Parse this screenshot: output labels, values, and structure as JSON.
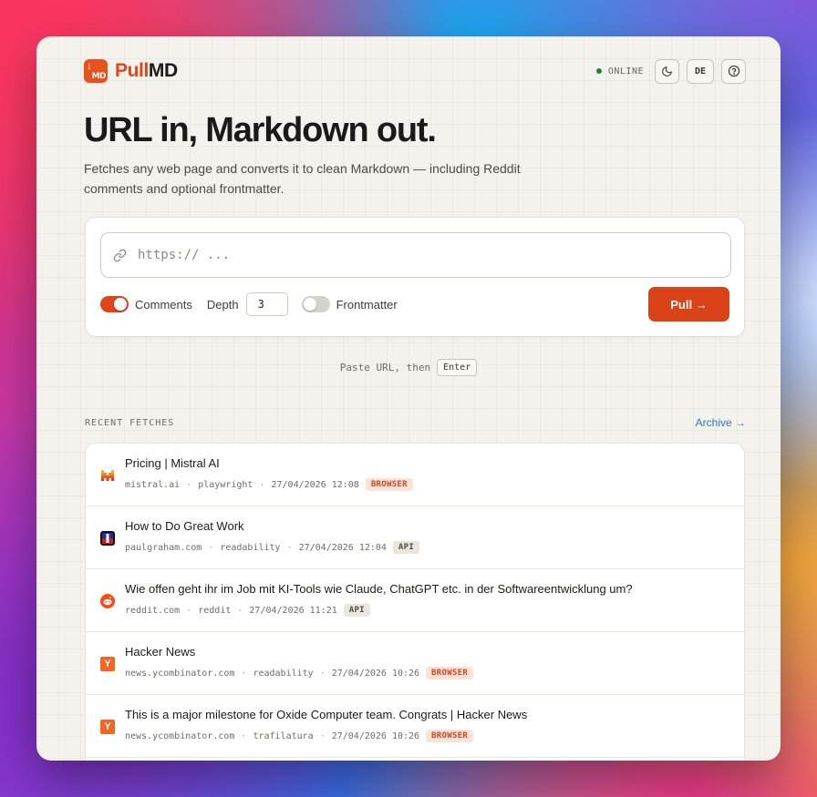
{
  "brand": {
    "name_part1": "Pull",
    "name_part2": "MD"
  },
  "status": {
    "text": "ONLINE",
    "color": "#2f7a33"
  },
  "header_buttons": {
    "theme_icon": "moon-icon",
    "language": "DE",
    "help_icon": "help-icon"
  },
  "hero": {
    "title": "URL in, Markdown out.",
    "subtitle": "Fetches any web page and converts it to clean Markdown — including Reddit comments and optional frontmatter."
  },
  "fetch_form": {
    "url_placeholder": "https:// ...",
    "url_value": "",
    "comments_label": "Comments",
    "comments_enabled": true,
    "depth_label": "Depth",
    "depth_value": "3",
    "frontmatter_label": "Frontmatter",
    "frontmatter_enabled": false,
    "pull_label": "Pull →",
    "accent_color": "#da4318"
  },
  "hint": {
    "text": "Paste URL, then",
    "key": "Enter"
  },
  "recent": {
    "title": "RECENT FETCHES",
    "archive_label": "Archive →",
    "items": [
      {
        "title": "Pricing | Mistral AI",
        "domain": "mistral.ai",
        "extractor": "playwright",
        "time": "27/04/2026 12:08",
        "badge": "BROWSER",
        "favicon": "mistral-icon"
      },
      {
        "title": "How to Do Great Work",
        "domain": "paulgraham.com",
        "extractor": "readability",
        "time": "27/04/2026 12:04",
        "badge": "API",
        "favicon": "paulgraham-icon"
      },
      {
        "title": "Wie offen geht ihr im Job mit KI-Tools wie Claude, ChatGPT etc. in der Softwareentwicklung um?",
        "domain": "reddit.com",
        "extractor": "reddit",
        "time": "27/04/2026 11:21",
        "badge": "API",
        "favicon": "reddit-icon"
      },
      {
        "title": "Hacker News",
        "domain": "news.ycombinator.com",
        "extractor": "readability",
        "time": "27/04/2026 10:26",
        "badge": "BROWSER",
        "favicon": "ycombinator-icon"
      },
      {
        "title": "This is a major milestone for Oxide Computer team. Congrats | Hacker News",
        "domain": "news.ycombinator.com",
        "extractor": "trafilatura",
        "time": "27/04/2026 10:26",
        "badge": "BROWSER",
        "favicon": "ycombinator-icon"
      }
    ]
  }
}
